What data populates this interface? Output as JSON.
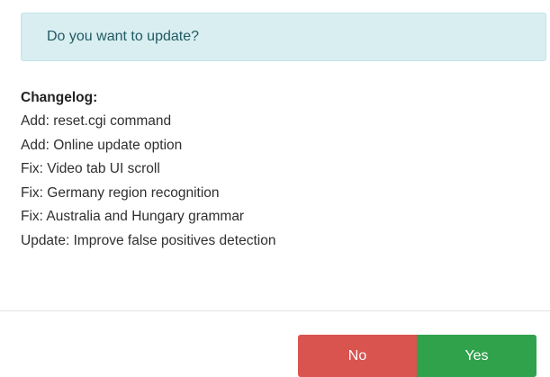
{
  "alert": {
    "message": "Do you want to update?"
  },
  "changelog": {
    "title": "Changelog:",
    "items": [
      "Add: reset.cgi command",
      "Add: Online update option",
      "Fix: Video tab UI scroll",
      "Fix: Germany region recognition",
      "Fix: Australia and Hungary grammar",
      "Update: Improve false positives detection"
    ]
  },
  "buttons": {
    "no_label": "No",
    "yes_label": "Yes"
  },
  "colors": {
    "alert_background": "#d8eef1",
    "alert_text": "#235a63",
    "no_button": "#d9534f",
    "yes_button": "#31a24c"
  }
}
